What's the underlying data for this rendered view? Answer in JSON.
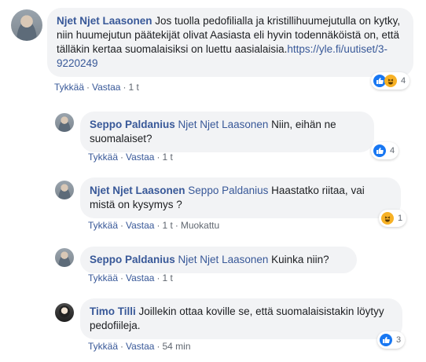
{
  "comments": [
    {
      "author": "Njet Njet Laasonen",
      "text": " Jos tuolla pedofilialla ja kristillihuumejutulla on kytky, niin huumejutun päätekijät olivat Aasiasta eli hyvin todennäköistä on, että tälläkin kertaa suomalaisiksi on luettu aasialaisia.",
      "link": "https://yle.fi/uutiset/3-9220249",
      "actions": [
        "Tykkää",
        "Vastaa"
      ],
      "time": "1 t",
      "reactions": [
        "like",
        "haha"
      ],
      "reaction_count": "4"
    },
    {
      "author": "Seppo Paldanius",
      "mention": "Njet Njet Laasonen",
      "text": " Niin, eihän ne suomalaiset?",
      "actions": [
        "Tykkää",
        "Vastaa"
      ],
      "time": "1 t",
      "reactions": [
        "like"
      ],
      "reaction_count": "4"
    },
    {
      "author": "Njet Njet Laasonen",
      "mention": "Seppo Paldanius",
      "text": " Haastatko riitaa, vai mistä on kysymys ?",
      "actions": [
        "Tykkää",
        "Vastaa"
      ],
      "time": "1 t",
      "edited": "Muokattu",
      "reactions": [
        "haha"
      ],
      "reaction_count": "1"
    },
    {
      "author": "Seppo Paldanius",
      "mention": "Njet Njet Laasonen",
      "text": " Kuinka niin?",
      "actions": [
        "Tykkää",
        "Vastaa"
      ],
      "time": "1 t"
    },
    {
      "author": "Timo Tilli",
      "text": " Joillekin ottaa koville se, että suomalaisistakin löytyy pedofiileja.",
      "actions": [
        "Tykkää",
        "Vastaa"
      ],
      "time": "54 min",
      "reactions": [
        "like"
      ],
      "reaction_count": "3"
    }
  ],
  "separator": "·",
  "colors": {
    "link": "#385898",
    "bubble": "#f2f3f5",
    "like": "#1877f2",
    "haha": "#f7b125"
  }
}
